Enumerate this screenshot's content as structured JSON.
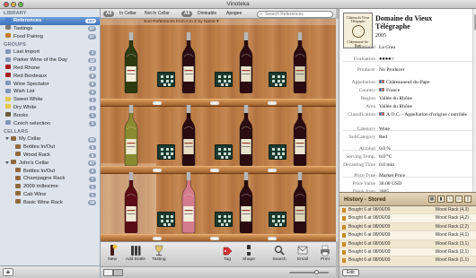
{
  "window": {
    "title": "Vinoteka"
  },
  "sidebar": {
    "library_header": "LIBRARY",
    "library": [
      {
        "label": "References",
        "count": "107",
        "selected": true,
        "color": "#4a7ed0"
      },
      {
        "label": "Tastings",
        "count": "27",
        "color": "#7a7a7a"
      },
      {
        "label": "Food Pairing",
        "count": "27",
        "color": "#c07d2a"
      }
    ],
    "groups_header": "GROUPS",
    "groups": [
      {
        "label": "Last Import",
        "count": "1",
        "color": "#7f97b8"
      },
      {
        "label": "Parker Wine of the Day",
        "count": "10",
        "color": "#7f97b8"
      },
      {
        "label": "Red Rhone",
        "count": "8",
        "color": "#a32020"
      },
      {
        "label": "Red Bordeaux",
        "count": "8",
        "color": "#a32020"
      },
      {
        "label": "Wine Spectator",
        "count": "8",
        "color": "#7f97b8"
      },
      {
        "label": "Wish List",
        "count": "0",
        "color": "#7f97b8"
      },
      {
        "label": "Sweet White",
        "count": "1",
        "color": "#e2c84c"
      },
      {
        "label": "Dry White",
        "count": "1",
        "color": "#e2c84c"
      },
      {
        "label": "Books",
        "count": "1",
        "color": "#6c5a3a"
      },
      {
        "label": "Czech selection",
        "count": "2",
        "color": "#7f97b8"
      }
    ],
    "cellars_header": "CELLARS",
    "cellars": [
      {
        "label": "My Cellar",
        "count": "45",
        "level": 0,
        "expanded": true,
        "color": "#8e6a3e"
      },
      {
        "label": "Bottles In/Out",
        "count": "0",
        "level": 1,
        "color": "#8e6a3e"
      },
      {
        "label": "Wood Rack",
        "count": "8",
        "level": 1,
        "color": "#8e6a3e"
      },
      {
        "label": "John's Cellar",
        "count": "47",
        "level": 0,
        "expanded": true,
        "color": "#8e6a3e"
      },
      {
        "label": "Bottles In/Out",
        "count": "0",
        "level": 1,
        "color": "#8e6a3e"
      },
      {
        "label": "Champagne Rack",
        "count": "7",
        "level": 1,
        "color": "#8e6a3e"
      },
      {
        "label": "2009 millesime",
        "count": "1",
        "level": 1,
        "color": "#8e6a3e"
      },
      {
        "label": "Cab Wine",
        "count": "1",
        "level": 1,
        "color": "#8e6a3e"
      },
      {
        "label": "Basic Wine Rack",
        "count": "19",
        "level": 1,
        "color": "#8e6a3e"
      }
    ],
    "add_button": "+"
  },
  "filters": {
    "group1": [
      "All",
      "In Cellar",
      "Not In Cellar"
    ],
    "group2": [
      "All",
      "Drinkable",
      "Apogee"
    ],
    "active1": 0,
    "active2": 0,
    "search_placeholder": "Search References"
  },
  "sortbar": {
    "text": "Sort References from   A to Z    by    Name ▾"
  },
  "toolbar": {
    "items": [
      {
        "label": "New",
        "icon": "new-wine-icon"
      },
      {
        "label": "Add Bottle",
        "icon": "add-bottle-icon"
      },
      {
        "label": "Tasting",
        "icon": "tasting-icon"
      },
      {
        "label": "Tag",
        "icon": "tag-icon"
      },
      {
        "label": "Shape",
        "icon": "shape-icon"
      },
      {
        "label": "Search",
        "icon": "search-icon"
      },
      {
        "label": "Email",
        "icon": "email-icon"
      },
      {
        "label": "Print",
        "icon": "print-icon"
      }
    ]
  },
  "detail": {
    "label_lines": [
      "Château du Vieux",
      "Télégraphe",
      "Châteauneuf-du-Pape"
    ],
    "title": "Domaine du Vieux Télégraphe",
    "year": "2005",
    "rows": [
      {
        "k": "Additional",
        "v": "La Crau",
        "flag": false
      },
      {
        "k": "Evaluation",
        "v": "●●●●○",
        "flag": false
      },
      {
        "k": "Producer",
        "v": "No Producer",
        "flag": false
      },
      {
        "k": "Appellation",
        "v": "Châteauneuf-du-Pape",
        "flag": true
      },
      {
        "k": "Country",
        "v": "France",
        "flag": true
      },
      {
        "k": "Region",
        "v": "Vallée du Rhône",
        "flag": false
      },
      {
        "k": "Area",
        "v": "Vallée du Rhône",
        "flag": false
      },
      {
        "k": "Classification",
        "v": "A.O.C. - Appellation d'origine contrôlée",
        "flag": true
      },
      {
        "k": "Category",
        "v": "Wine",
        "flag": false
      },
      {
        "k": "SubCategory",
        "v": "Red",
        "flag": false
      },
      {
        "k": "Alcohol",
        "v": "0.0 %",
        "flag": false
      },
      {
        "k": "Serving Temp.",
        "v": "0.0 °C",
        "flag": false
      },
      {
        "k": "Decanting Time",
        "v": "0.0 min",
        "flag": false
      },
      {
        "k": "Price Type",
        "v": "Market Price",
        "flag": false
      },
      {
        "k": "Price Value",
        "v": "30.00    USD",
        "flag": false
      },
      {
        "k": "Drink from",
        "v": "2005",
        "flag": false
      }
    ]
  },
  "history": {
    "title": "History - Stored",
    "rows": [
      {
        "text": "Bought 6 at 08/06/09",
        "rack": "Wood Rack (4,3)"
      },
      {
        "text": "Bought 6 at 08/06/09",
        "rack": "Wood Rack (4,2)"
      },
      {
        "text": "Bought 6 at 08/06/09",
        "rack": "Wood Rack (2,2)"
      },
      {
        "text": "Bought 6 at 08/06/09",
        "rack": "Wood Rack (4,1)"
      },
      {
        "text": "Bought 6 at 08/06/09",
        "rack": "Wood Rack (3,1)"
      },
      {
        "text": "Bought 6 at 08/06/09",
        "rack": "Wood Rack (2,1)"
      },
      {
        "text": "Bought 6 at 08/06/09",
        "rack": "Wood Rack (1,1)"
      }
    ],
    "edit_button": "Edit"
  },
  "shelf": {
    "rows": [
      [
        {
          "wine": "white",
          "bottle": "#2e3a10",
          "label": "#f3eedc"
        },
        {
          "wine": "red",
          "bottle": "#2b0d12",
          "label": "#ece6d2"
        },
        {
          "wine": "red",
          "bottle": "#2a0b10",
          "label": "#e9e3cf"
        },
        {
          "wine": "red",
          "bottle": "#2a0b10",
          "label": "#d8d0b4"
        }
      ],
      [
        {
          "wine": "white",
          "bottle": "#8a8a30",
          "label": "#efe9d2"
        },
        {
          "wine": "red",
          "bottle": "#2a0b10",
          "label": "#e6dcc2"
        },
        {
          "wine": "red",
          "bottle": "#2b0d12",
          "label": "#eae4cf"
        },
        {
          "wine": "red",
          "bottle": "#2a0b10",
          "label": "#ece6d1"
        }
      ],
      [
        {
          "wine": "red",
          "bottle": "#5a0d16",
          "label": "#f0e8d4"
        },
        {
          "wine": "rose",
          "bottle": "#d47b8c",
          "label": "#f2ecdb"
        },
        {
          "wine": "red",
          "bottle": "#2a0b10",
          "label": "#ece6d1"
        },
        {
          "wine": "red",
          "bottle": "#2a0b10",
          "label": "#dcd3b8"
        }
      ]
    ]
  }
}
